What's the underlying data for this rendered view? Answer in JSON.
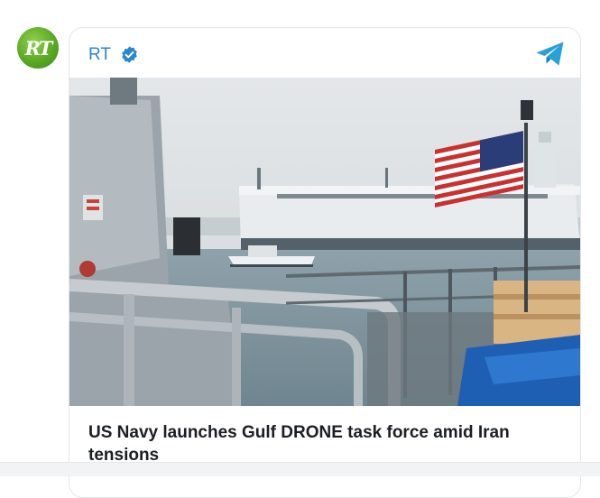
{
  "post": {
    "channel": {
      "name": "RT",
      "avatar_text": "RT",
      "verified": true,
      "brand_color": "#2a87d0"
    },
    "image": {
      "icon": "news-photo-icon"
    },
    "headline": "US Navy launches Gulf DRONE task force amid Iran tensions"
  },
  "icons": {
    "share": "telegram-icon",
    "verified": "verified-badge-icon"
  }
}
